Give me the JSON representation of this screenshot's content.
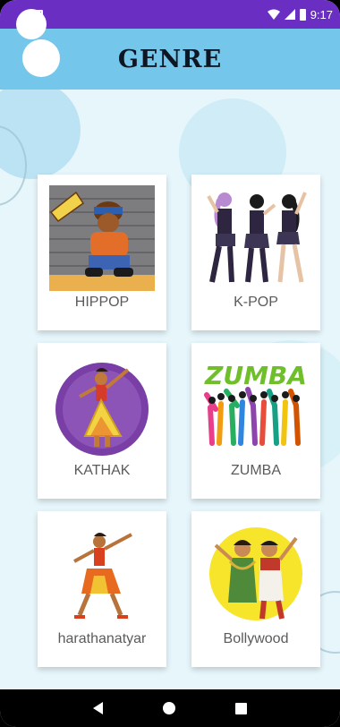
{
  "status_bar": {
    "time": "9:17",
    "icons": [
      "wifi-icon",
      "signal-icon",
      "battery-icon",
      "sim-icon"
    ]
  },
  "header": {
    "title": "GENRE"
  },
  "genres": [
    {
      "label": "HIPPOP",
      "icon": "hiphop-dancer-image"
    },
    {
      "label": "K-POP",
      "icon": "kpop-dancers-image"
    },
    {
      "label": "KATHAK",
      "icon": "kathak-dancer-image"
    },
    {
      "label": "ZUMBA",
      "icon": "zumba-dancers-image"
    },
    {
      "label": "harathanatyar",
      "icon": "bharatanatyam-dancer-image"
    },
    {
      "label": "Bollywood",
      "icon": "bollywood-couple-image"
    }
  ],
  "colors": {
    "status_bar": "#6a2fc2",
    "header": "#74c6ea",
    "background": "#e6f6fb",
    "card": "#ffffff",
    "label_text": "#5b5b5b"
  },
  "nav": {
    "icons": [
      "back-icon",
      "home-icon",
      "recents-icon"
    ]
  }
}
